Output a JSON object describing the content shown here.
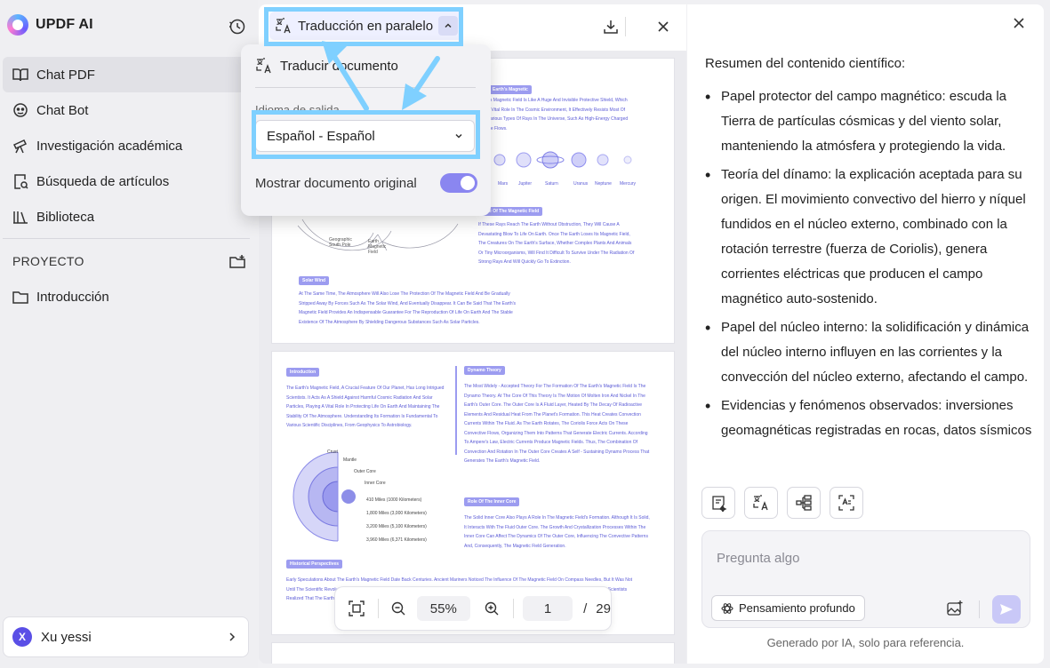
{
  "app": {
    "name": "UPDF AI"
  },
  "sidebar": {
    "items": [
      {
        "label": "Chat PDF",
        "icon": "book-icon"
      },
      {
        "label": "Chat Bot",
        "icon": "bot-icon"
      },
      {
        "label": "Investigación académica",
        "icon": "telescope-icon"
      },
      {
        "label": "Búsqueda de artículos",
        "icon": "doc-search-icon"
      },
      {
        "label": "Biblioteca",
        "icon": "library-icon"
      }
    ],
    "project_section": "PROYECTO",
    "projects": [
      {
        "label": "Introducción",
        "icon": "folder-icon"
      }
    ],
    "user": {
      "initial": "X",
      "name": "Xu yessi"
    }
  },
  "viewer": {
    "mode_label": "Traducción en paralelo",
    "zoom": "55%",
    "page_current": "1",
    "page_sep": "/",
    "page_total": "29"
  },
  "dropdown": {
    "translate_doc": "Traducir documento",
    "output_language_label": "Idioma de salida",
    "output_language_value": "Español - Español",
    "show_original_label": "Mostrar documento original",
    "show_original_on": true
  },
  "pdf": {
    "p1": {
      "h_magnetic": "Earth's Magnetic",
      "t_magnetic": "Earth's Magnetic Field Is Like A Huge And Invisible Protective Shield, Which Has A Vital Role In The Cosmic Environment, It Effectively Resists Most Of The Various Types Of Rays In The Universe, Such As High-Energy Charged Particle Flows.",
      "planet_labels": [
        "Mars",
        "Jupiter",
        "Saturn",
        "Uranus",
        "Neptune",
        "Mercury"
      ],
      "h_role": "Role Of The Magnetic Field",
      "t_role": "If These Rays Reach The Earth Without Obstruction, They Will Cause A Devastating Blow To Life On Earth. Once The Earth Loses Its Magnetic Field, The Creatures On The Earth's Surface, Whether Complex Plants And Animals Or Tiny Microorganisms, Will Find It Difficult To Survive Under The Radiation Of Strong Rays And Will Quickly Go To Extinction.",
      "fig_labels": [
        "Geographic South Pole",
        "Earth Magnetic Field"
      ],
      "h_solar": "Solar Wind",
      "t_solar": "At The Same Time, The Atmosphere Will Also Lose The Protection Of The Magnetic Field And Be Gradually Stripped Away By Forces Such As The Solar Wind, And Eventually Disappear. It Can Be Said That The Earth's Magnetic Field Provides An Indispensable Guarantee For The Reproduction Of Life On Earth And The Stable Existence Of The Atmosphere By Shielding Dangerous Substances Such As Solar Particles."
    },
    "p2": {
      "h_intro": "Introduction",
      "t_intro": "The Earth's Magnetic Field, A Crucial Feature Of Our Planet, Has Long Intrigued Scientists. It Acts As A Shield Against Harmful Cosmic Radiation And Solar Particles, Playing A Vital Role In Protecting Life On Earth And Maintaining The Stability Of The Atmosphere. Understanding Its Formation Is Fundamental To Various Scientific Disciplines, From Geophysics To Astrobiology.",
      "layers": [
        "Crust",
        "Mantle",
        "Outer Core",
        "Inner Core"
      ],
      "depths": [
        "410 Miles (1000 Kilometers)",
        "1,800 Miles (3,000 Kilometers)",
        "3,200 Miles (5,100 Kilometers)",
        "3,960 Miles (6,371 Kilometers)"
      ],
      "h_dynamo": "Dynamo Theory",
      "t_dynamo": "The Most Widely - Accepted Theory For The Formation Of The Earth's Magnetic Field Is The Dynamo Theory. At The Core Of This Theory Is The Motion Of Molten Iron And Nickel In The Earth's Outer Core. The Outer Core Is A Fluid Layer, Heated By The Decay Of Radioactive Elements And Residual Heat From The Planet's Formation. This Heat Creates Convection Currents Within The Fluid. As The Earth Rotates, The Coriolis Force Acts On These Convective Flows, Organizing Them Into Patterns That Generate Electric Currents. According To Ampere's Law, Electric Currents Produce Magnetic Fields. Thus, The Combination Of Convection And Rotation In The Outer Core Creates A Self - Sustaining Dynamo Process That Generates The Earth's Magnetic Field.",
      "h_inner": "Role Of The Inner Core",
      "t_inner": "The Solid Inner Core Also Plays A Role In The Magnetic Field's Formation. Although It Is Solid, It Interacts With The Fluid Outer Core. The Growth And Crystallization Processes Within The Inner Core Can Affect The Dynamics Of The Outer Core, Influencing The Convective Patterns And, Consequently, The Magnetic Field Generation.",
      "h_hist": "Historical Perspectives",
      "t_hist": "Early Speculations About The Earth's Magnetic Field Date Back Centuries. Ancient Mariners Noticed The Influence Of The Magnetic Field On Compass Needles, But It Was Not Until The Scientific Revolution That Systematic Study Began. William Gilbert, In 1600, Proposed By Suggesting That The Earth Itself Is A Giant Magnet. Over Time, Scientists Realized That The Earth's Magnetic Field's Origin Has Evolved."
    }
  },
  "ai": {
    "summary_title": "Resumen del contenido científico:",
    "bullets": [
      "Papel protector del campo magnético: escuda la Tierra de partículas cósmicas y del viento solar, manteniendo la atmósfera y protegiendo la vida.",
      "Teoría del dínamo: la explicación aceptada para su origen. El movimiento convectivo del hierro y níquel fundidos en el núcleo externo, combinado con la rotación terrestre (fuerza de Coriolis), genera corrientes eléctricas que producen el campo magnético auto-sostenido.",
      "Papel del núcleo interno: la solidificación y dinámica del núcleo interno influyen en las corrientes y la convección del núcleo externo, afectando el campo.",
      "Evidencias y fenómenos observados: inversiones geomagnéticas registradas en rocas, datos sísmicos"
    ],
    "input_placeholder": "Pregunta algo",
    "deep_thinking": "Pensamiento profundo",
    "footnote": "Generado por IA, solo para referencia."
  },
  "colors": {
    "accent": "#6b5cf0",
    "highlight": "#7fd0ff",
    "doc_text": "#5b5bd6"
  }
}
